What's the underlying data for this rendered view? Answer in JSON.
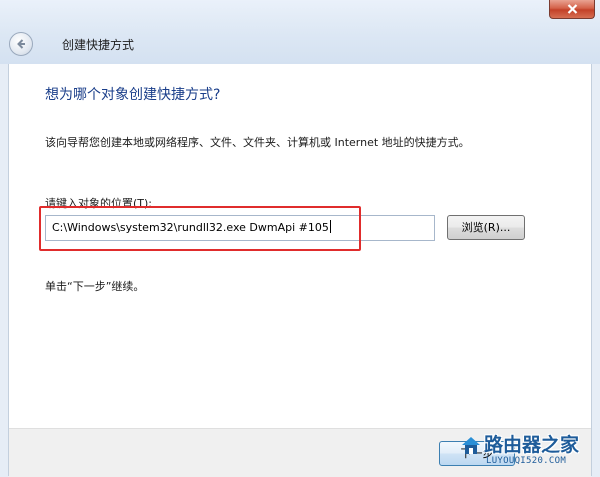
{
  "window": {
    "title": "创建快捷方式"
  },
  "wizard": {
    "heading": "想为哪个对象创建快捷方式?",
    "description": "该向导帮您创建本地或网络程序、文件、文件夹、计算机或 Internet 地址的快捷方式。",
    "location_label": "请键入对象的位置(T):",
    "location_value": "C:\\Windows\\system32\\rundll32.exe DwmApi #105",
    "browse_label": "浏览(R)...",
    "hint": "单击“下一步”继续。",
    "next_label": "下一步"
  },
  "watermark": {
    "name": "路由器之家",
    "url": "LUYOUQI520.COM"
  },
  "colors": {
    "heading": "#1a3e8a",
    "highlight_box": "#e02c2c",
    "close_button": "#c34128"
  },
  "icons": {
    "back": "back-arrow-icon",
    "close": "close-x-icon",
    "watermark_logo": "house-icon"
  }
}
